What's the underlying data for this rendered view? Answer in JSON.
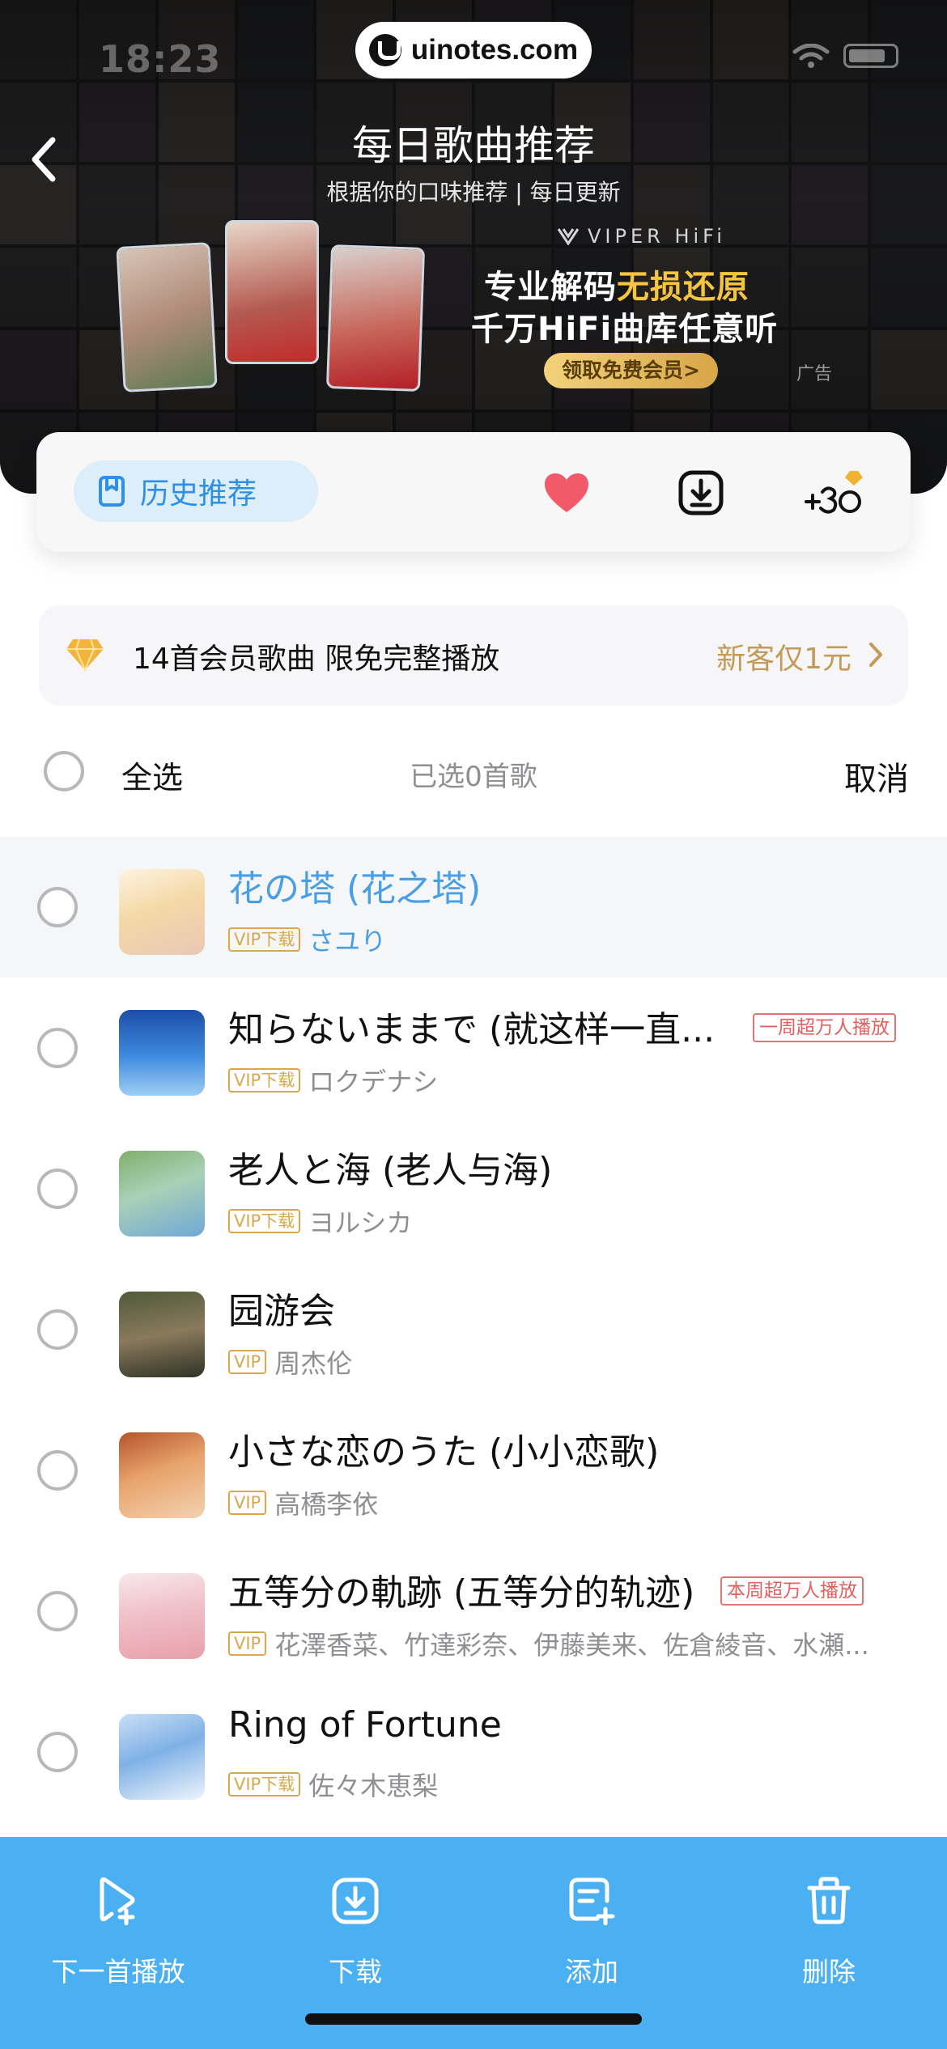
{
  "status_bar": {
    "time": "18:23"
  },
  "watermark": {
    "text": "uinotes.com"
  },
  "header": {
    "title": "每日歌曲推荐",
    "subtitle": "根据你的口味推荐 | 每日更新"
  },
  "ad": {
    "brand": "VIPER HiFi",
    "headline_part1": "专业解码",
    "headline_highlight": "无损还原",
    "headline_line2": "千万HiFi曲库任意听",
    "cta": "领取免费会员>",
    "tag": "广告"
  },
  "toolbar": {
    "history_label": "历史推荐",
    "icons": [
      "bookmark-icon",
      "heart-icon",
      "download-icon",
      "plus-30-icon"
    ],
    "accent_color": "#2f8fe3",
    "heart_color": "#f25a6a"
  },
  "vip_banner": {
    "text": "14首会员歌曲 限免完整播放",
    "offer": "新客仅1元"
  },
  "selection": {
    "select_all": "全选",
    "count_text": "已选0首歌",
    "cancel": "取消"
  },
  "songs": [
    {
      "title": "花の塔 (花之塔)",
      "badge": "VIP下载",
      "artist": "さユり",
      "tag": "",
      "active": true
    },
    {
      "title": "知らないままで (就这样一直...",
      "badge": "VIP下载",
      "artist": "ロクデナシ",
      "tag": "一周超万人播放"
    },
    {
      "title": "老人と海 (老人与海)",
      "badge": "VIP下载",
      "artist": "ヨルシカ",
      "tag": ""
    },
    {
      "title": "园游会",
      "badge": "VIP",
      "artist": "周杰伦",
      "tag": ""
    },
    {
      "title": "小さな恋のうた (小小恋歌)",
      "badge": "VIP",
      "artist": "高橋李依",
      "tag": ""
    },
    {
      "title": "五等分の軌跡 (五等分的轨迹)",
      "badge": "VIP",
      "artist": "花澤香菜、竹達彩奈、伊藤美来、佐倉綾音、水瀬...",
      "tag": "本周超万人播放"
    },
    {
      "title": "Ring of Fortune",
      "badge": "VIP下载",
      "artist": "佐々木恵梨",
      "tag": ""
    }
  ],
  "bottom_bar": {
    "items": [
      {
        "label": "下一首播放",
        "icon": "play-next-icon"
      },
      {
        "label": "下载",
        "icon": "download-icon"
      },
      {
        "label": "添加",
        "icon": "add-to-list-icon"
      },
      {
        "label": "删除",
        "icon": "trash-icon"
      }
    ],
    "background": "#4ab0f2"
  },
  "colors": {
    "vip_gold": "#d9a84d",
    "tag_red": "#e26060",
    "active_blue": "#4a9fe4"
  }
}
